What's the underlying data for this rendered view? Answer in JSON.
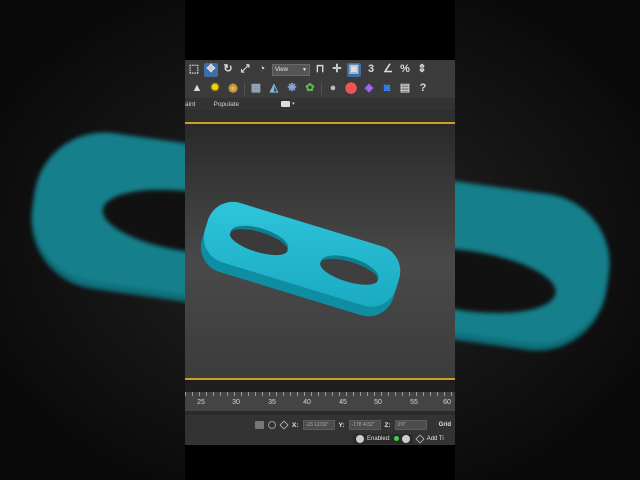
{
  "toolbar": {
    "view_select_value": "View",
    "icons": [
      "select-region-icon",
      "move-icon",
      "rotate-icon",
      "scale-icon",
      "paint-select-icon",
      "view-dropdown",
      "pivot-icon",
      "transform-gizmo-icon",
      "selection-filter-icon",
      "snap-3-icon",
      "angle-snap-icon",
      "percent-snap-icon",
      "spinner-snap-icon"
    ],
    "snap_label": "3",
    "percent_label": "%"
  },
  "toolbar2": {
    "icons": [
      "cone-icon",
      "light-icon",
      "camera-icon",
      "grid-helper-icon",
      "paint-icon",
      "particle-icon",
      "modifier-icon",
      "bones-icon",
      "render-setup-icon",
      "material-editor-icon",
      "render-frame-icon",
      "render-icon",
      "collapse-icon",
      "help-icon"
    ]
  },
  "ribbon": {
    "tabs": [
      "aint",
      "Populate"
    ]
  },
  "timeline": {
    "ruler_labels": [
      "25",
      "30",
      "35",
      "40",
      "45",
      "50",
      "55",
      "60"
    ]
  },
  "status": {
    "x_label": "X:",
    "x_value": "-23 12/32\"",
    "y_label": "Y:",
    "y_value": "-178 4/32\"",
    "z_label": "Z:",
    "z_value": "0'0\"",
    "grid_label": "Grid",
    "enabled_label": "Enabled:",
    "add_time_tag_label": "Add Ti"
  },
  "colors": {
    "object": "#1fb7cc",
    "object_shade": "#138a9c",
    "active_border": "#c9a227",
    "toolbar_active": "#3d6ea8"
  }
}
